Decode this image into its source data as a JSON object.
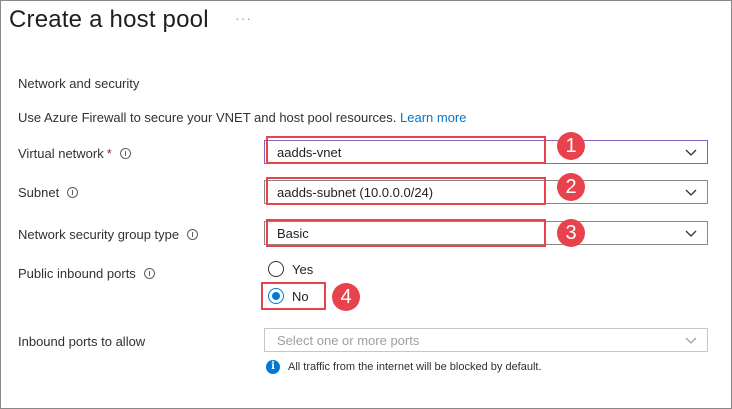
{
  "page": {
    "title": "Create a host pool",
    "more": "···"
  },
  "section": {
    "heading": "Network and security",
    "description": "Use Azure Firewall to secure your VNET and host pool resources.",
    "learn_more": "Learn more"
  },
  "fields": {
    "virtual_network": {
      "label": "Virtual network",
      "required_mark": "*",
      "value": "aadds-vnet"
    },
    "subnet": {
      "label": "Subnet",
      "value": "aadds-subnet (10.0.0.0/24)"
    },
    "nsg_type": {
      "label": "Network security group type",
      "value": "Basic"
    },
    "public_inbound": {
      "label": "Public inbound ports",
      "options": [
        {
          "label": "Yes",
          "selected": false
        },
        {
          "label": "No",
          "selected": true
        }
      ]
    },
    "inbound_ports": {
      "label": "Inbound ports to allow",
      "placeholder": "Select one or more ports"
    }
  },
  "note": {
    "icon": "info-icon",
    "text": "All traffic from the internet will be blocked by default."
  },
  "annotations": {
    "badges": [
      "1",
      "2",
      "3",
      "4"
    ],
    "color": "#e8424c"
  },
  "colors": {
    "link": "#0078d4",
    "focus": "#8764b8",
    "required": "#a4262c"
  }
}
